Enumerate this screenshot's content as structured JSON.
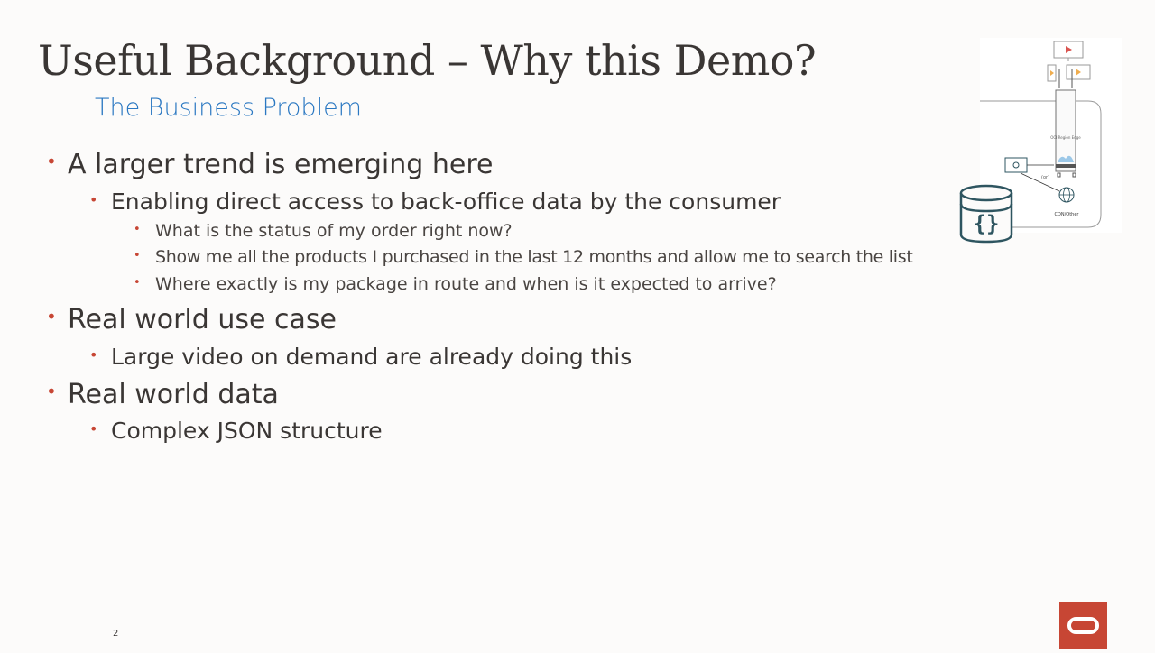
{
  "slide": {
    "title": "Useful Background – Why this Demo?",
    "subtitle": "The Business Problem",
    "page_number": "2",
    "bullets": [
      {
        "level": 1,
        "text": "A larger trend is emerging here"
      },
      {
        "level": 2,
        "text": "Enabling direct access to back-office data by the consumer"
      },
      {
        "level": 3,
        "text": "What is the status of my order right now?"
      },
      {
        "level": 3,
        "text": "Show me all the products I purchased in the last 12 months and allow me to search the list"
      },
      {
        "level": 3,
        "text": "Where exactly is my package in route and when is it expected to arrive?"
      },
      {
        "level": 1,
        "text": "Real world use case"
      },
      {
        "level": 2,
        "text": "Large video on demand are already doing this"
      },
      {
        "level": 1,
        "text": "Real world data"
      },
      {
        "level": 2,
        "text": "Complex JSON structure"
      }
    ],
    "bullet_glyph": "•",
    "diagram": {
      "labels": [
        "OCI Region Edge",
        "(or)",
        "CDN/Other"
      ]
    },
    "db_icon_glyph": "{}",
    "colors": {
      "background": "#fcfbfa",
      "title": "#3a3634",
      "subtitle": "#2b78c2",
      "bullet_dot": "#c74634",
      "brand_red": "#c74634",
      "icon_teal": "#2e5560"
    }
  }
}
